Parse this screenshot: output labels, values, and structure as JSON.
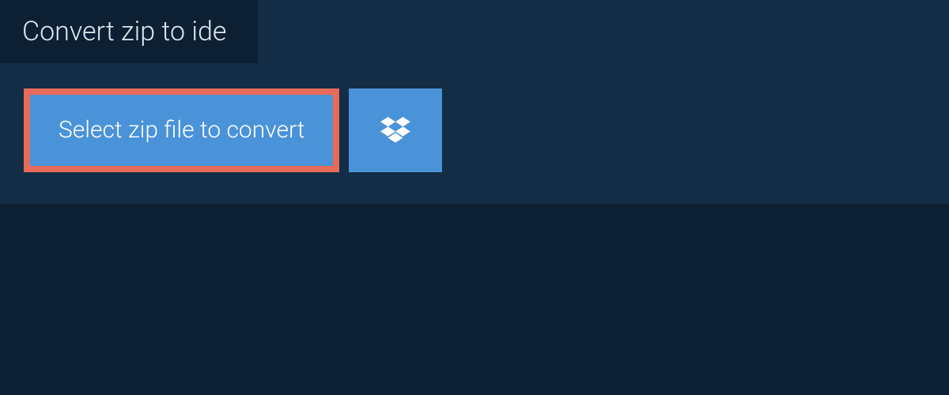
{
  "tab": {
    "label": "Convert zip to ide"
  },
  "main": {
    "select_button_label": "Select zip file to convert"
  },
  "colors": {
    "background_outer": "#0c1f33",
    "background_panel": "#132d46",
    "button_bg": "#4a93d9",
    "button_border_highlight": "#e76a5b",
    "text_light": "#ffffff",
    "text_muted": "#dfe7ee"
  },
  "icons": {
    "dropbox": "dropbox-icon"
  }
}
